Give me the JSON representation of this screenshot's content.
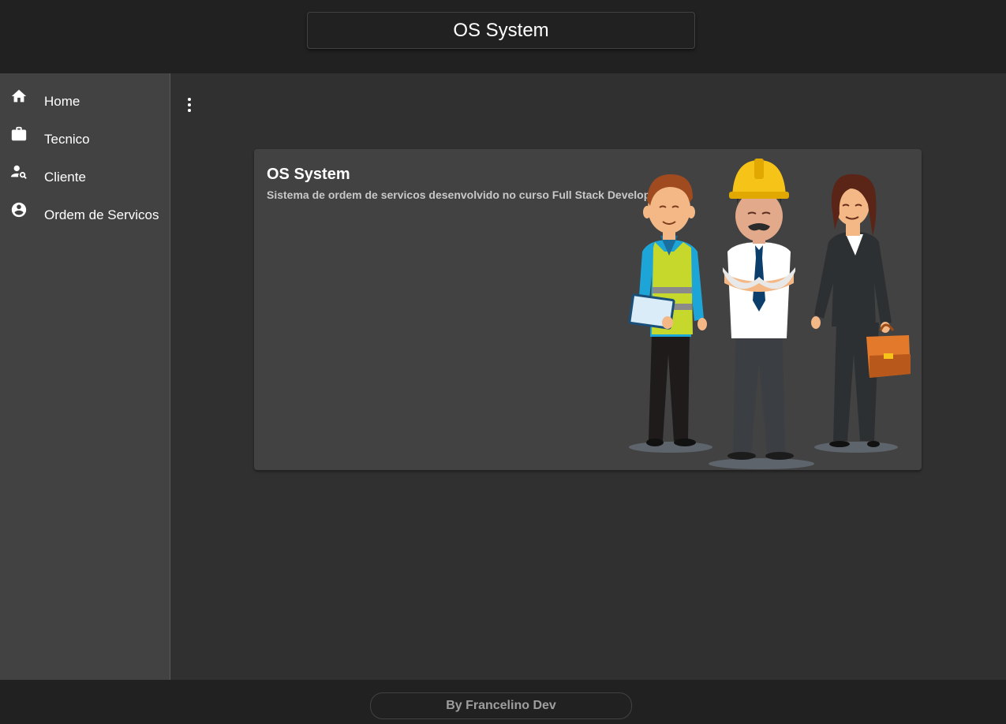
{
  "header": {
    "title": "OS System"
  },
  "sidebar": {
    "items": [
      {
        "label": "Home",
        "icon": "home-icon"
      },
      {
        "label": "Tecnico",
        "icon": "briefcase-icon"
      },
      {
        "label": "Cliente",
        "icon": "person-search-icon"
      },
      {
        "label": "Ordem de Servicos",
        "icon": "account-circle-icon"
      }
    ]
  },
  "main": {
    "menu_icon": "more-vert-icon",
    "card": {
      "title": "OS System",
      "subtitle": "Sistema de ordem de servicos desenvolvido no curso Full Stack Develop",
      "illustration": "workers-illustration"
    }
  },
  "footer": {
    "text": "By Francelino Dev"
  },
  "colors": {
    "toolbar": "#212121",
    "sidebar": "#424242",
    "background": "#303030",
    "card": "#424242",
    "text": "#ffffff"
  }
}
